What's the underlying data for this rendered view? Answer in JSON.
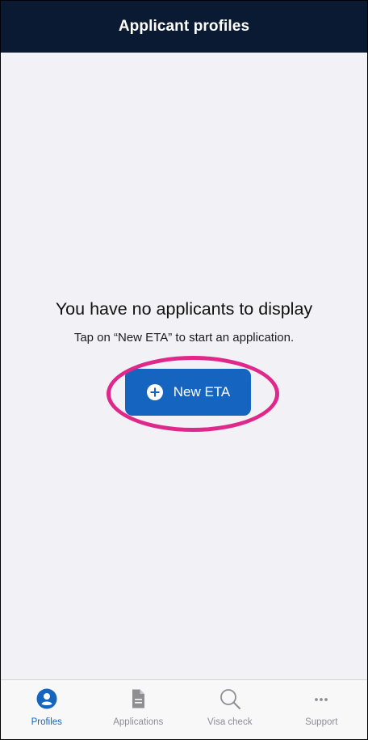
{
  "header": {
    "title": "Applicant profiles"
  },
  "empty_state": {
    "title": "You have no applicants to display",
    "subtitle": "Tap on “New ETA” to start an application."
  },
  "primary_action": {
    "label": "New ETA",
    "icon": "plus-circle-icon"
  },
  "tabbar": {
    "tabs": [
      {
        "label": "Profiles",
        "icon": "person-circle-icon",
        "active": true
      },
      {
        "label": "Applications",
        "icon": "document-icon",
        "active": false
      },
      {
        "label": "Visa check",
        "icon": "search-icon",
        "active": false
      },
      {
        "label": "Support",
        "icon": "more-dots-icon",
        "active": false
      }
    ]
  },
  "colors": {
    "header_bg": "#0b1a33",
    "accent": "#1565c0",
    "highlight": "#e0278a",
    "background": "#f2f1f6"
  }
}
